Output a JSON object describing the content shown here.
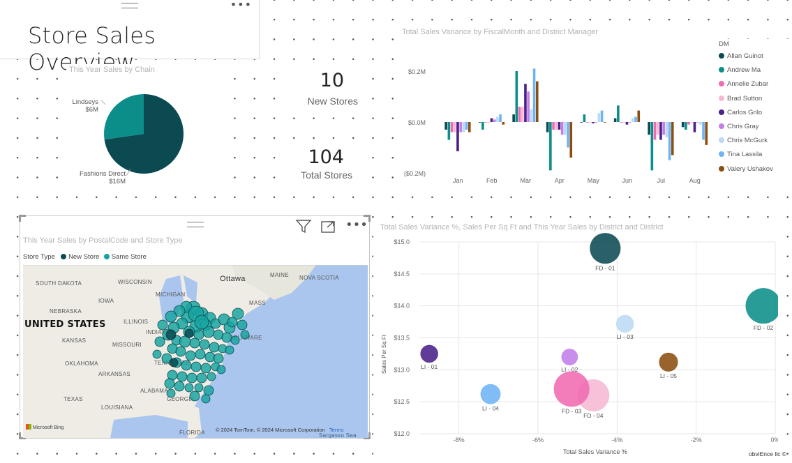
{
  "header": {
    "title": "Store Sales Overview",
    "menu_glyph": "•••"
  },
  "pie_chart": {
    "title": "This Year Sales by Chain",
    "slices": [
      {
        "name": "Lindseys",
        "value_label": "$6M",
        "value": 6,
        "color": "#0b8e8a"
      },
      {
        "name": "Fashions Direct",
        "value_label": "$16M",
        "value": 16,
        "color": "#0c4a52"
      }
    ]
  },
  "cards": {
    "new_stores": {
      "value": "10",
      "label": "New Stores"
    },
    "total_stores": {
      "value": "104",
      "label": "Total Stores"
    }
  },
  "bar_chart": {
    "title": "Total Sales Variance by FiscalMonth and District Manager",
    "legend_title": "DM",
    "y_ticks": [
      "$0.2M",
      "$0.0M",
      "($0.2M)"
    ],
    "chart_data": {
      "type": "bar",
      "categories": [
        "Jan",
        "Feb",
        "Mar",
        "Apr",
        "May",
        "Jun",
        "Jul",
        "Aug"
      ],
      "ylim": [
        -0.2,
        0.2
      ],
      "series": [
        {
          "name": "Allan Guinot",
          "color": "#0c4a52",
          "values": [
            -0.03,
            0.0,
            0.03,
            -0.04,
            0.0,
            0.015,
            -0.05,
            -0.02
          ]
        },
        {
          "name": "Andrew Ma",
          "color": "#0b8e8a",
          "values": [
            -0.07,
            -0.03,
            0.2,
            -0.19,
            0.03,
            0.065,
            -0.19,
            -0.03
          ]
        },
        {
          "name": "Annelie Zubar",
          "color": "#f06bb0",
          "values": [
            -0.04,
            0.0,
            0.06,
            -0.03,
            0.0,
            0.0,
            -0.07,
            -0.01
          ]
        },
        {
          "name": "Brad Sutton",
          "color": "#f5b8d4",
          "values": [
            -0.04,
            0.0,
            0.06,
            -0.03,
            0.0,
            0.0,
            -0.05,
            0.0
          ]
        },
        {
          "name": "Carlos Grilo",
          "color": "#4a2089",
          "values": [
            -0.115,
            0.015,
            0.15,
            -0.03,
            -0.005,
            -0.01,
            -0.07,
            -0.04
          ]
        },
        {
          "name": "Chris Gray",
          "color": "#c27ee8",
          "values": [
            -0.04,
            0.01,
            0.12,
            -0.05,
            0.0,
            0.0,
            -0.05,
            0.0
          ]
        },
        {
          "name": "Chris McGurk",
          "color": "#bcd9f5",
          "values": [
            -0.04,
            0.02,
            0.05,
            -0.05,
            0.035,
            0.015,
            -0.06,
            -0.01
          ]
        },
        {
          "name": "Tina Lassila",
          "color": "#6eb4f5",
          "values": [
            -0.03,
            0.03,
            0.21,
            -0.1,
            0.045,
            0.02,
            -0.15,
            -0.07
          ]
        },
        {
          "name": "Valery Ushakov",
          "color": "#8b4d10",
          "values": [
            -0.04,
            -0.01,
            0.16,
            -0.14,
            0.0,
            0.045,
            -0.13,
            -0.09
          ]
        }
      ]
    }
  },
  "map_visual": {
    "title": "This Year Sales by PostalCode and Store Type",
    "legend_label": "Store Type",
    "legend_items": [
      {
        "name": "New Store",
        "color": "#0c4a52"
      },
      {
        "name": "Same Store",
        "color": "#15a3a0"
      }
    ],
    "country_label": "UNITED STATES",
    "regions": [
      "SOUTH DAKOTA",
      "WISCONSIN",
      "MICHIGAN",
      "Ottawa",
      "MAINE",
      "NOVA SCOTIA",
      "IOWA",
      "NEBRASKA",
      "ILLINOIS",
      "INDIANA",
      "KANSAS",
      "MISSOURI",
      "OKLAHOMA",
      "ARKANSAS",
      "TENNESSEE",
      "TEXAS",
      "LOUISIANA",
      "ALABAMA",
      "GEORGIA",
      "FLORIDA",
      "MASS",
      "DELAWARE",
      "Sargasso Sea"
    ],
    "attribution": "© 2024 TomTom, © 2024 Microsoft Corporation",
    "terms": "Terms",
    "bing_logo": "Microsoft Bing",
    "icons": [
      "filter-icon",
      "focus-mode-icon",
      "more-options-icon"
    ]
  },
  "scatter_chart": {
    "title": "Total Sales Variance %, Sales Per Sq Ft and This Year Sales by District and District",
    "xlabel": "Total Sales Variance %",
    "ylabel": "Sales Per Sq Ft",
    "x_ticks": [
      "-8%",
      "-6%",
      "-4%",
      "-2%",
      "0%"
    ],
    "y_ticks": [
      "$15.0",
      "$14.5",
      "$14.0",
      "$13.5",
      "$13.0",
      "$12.5",
      "$12.0"
    ],
    "chart_data": {
      "type": "scatter",
      "xlim": [
        -9,
        0
      ],
      "ylim": [
        12.0,
        15.0
      ],
      "points": [
        {
          "label": "FD - 01",
          "x": -4.3,
          "y": 14.9,
          "size": 1.3,
          "color": "#0c4a52"
        },
        {
          "label": "FD - 02",
          "x": -0.3,
          "y": 14.0,
          "size": 1.5,
          "color": "#0b8e8a"
        },
        {
          "label": "LI - 03",
          "x": -3.8,
          "y": 13.72,
          "size": 0.75,
          "color": "#bcd9f5"
        },
        {
          "label": "LI - 01",
          "x": -8.75,
          "y": 13.25,
          "size": 0.75,
          "color": "#4a2089"
        },
        {
          "label": "LI - 02",
          "x": -5.2,
          "y": 13.2,
          "size": 0.7,
          "color": "#c27ee8"
        },
        {
          "label": "FD - 04",
          "x": -4.6,
          "y": 12.6,
          "size": 1.35,
          "color": "#f5b8d4"
        },
        {
          "label": "LI - 05",
          "x": -2.7,
          "y": 13.12,
          "size": 0.8,
          "color": "#8b4d10"
        },
        {
          "label": "FD - 03",
          "x": -5.15,
          "y": 12.7,
          "size": 1.5,
          "color": "#f06bb0"
        },
        {
          "label": "LI - 04",
          "x": -7.2,
          "y": 12.62,
          "size": 0.85,
          "color": "#6eb4f5"
        }
      ]
    }
  },
  "footer": {
    "brand": "obviEnce llc ©"
  }
}
